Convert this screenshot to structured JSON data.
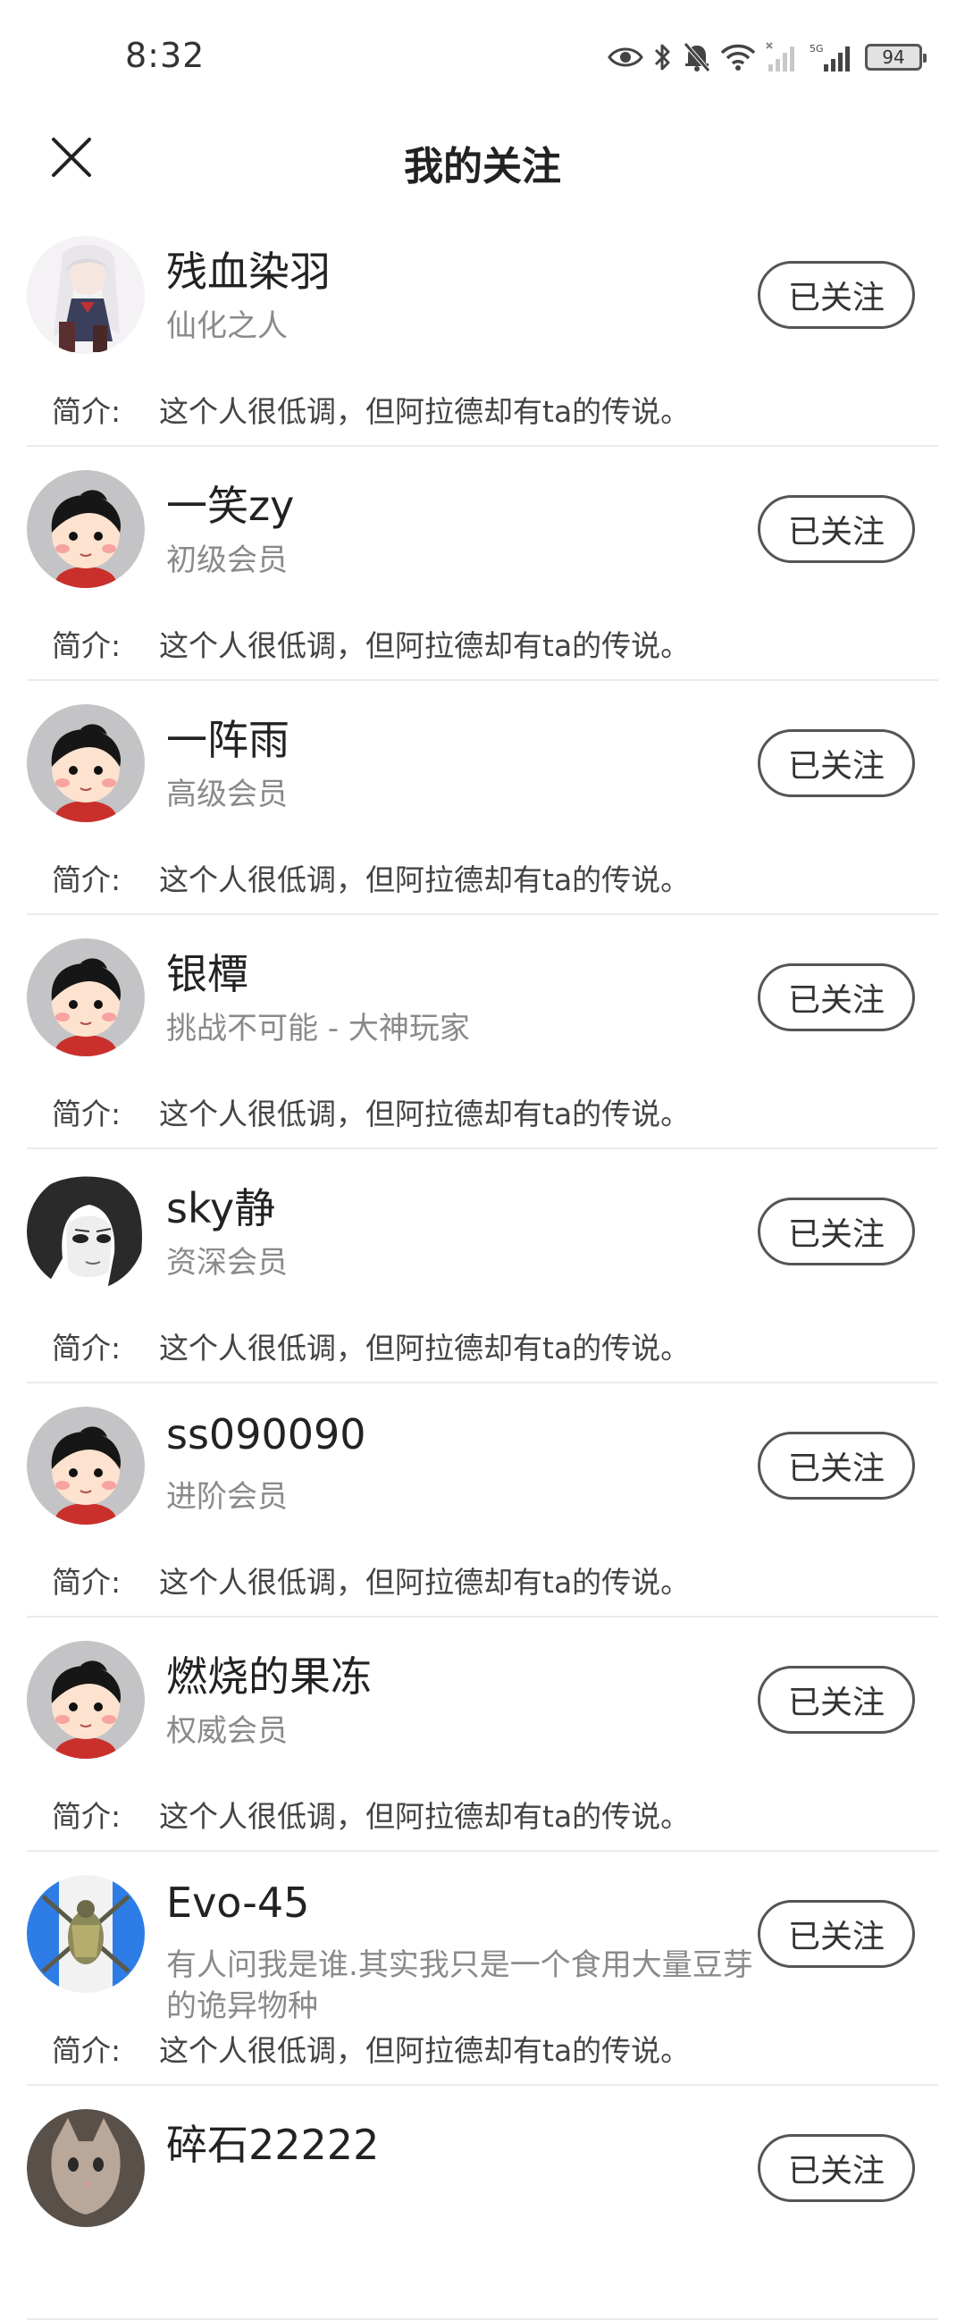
{
  "status_bar": {
    "time": "8:32",
    "battery": "94",
    "icons": [
      "eye-icon",
      "bluetooth-icon",
      "mute-bell-icon",
      "wifi-icon",
      "no-signal-icon",
      "signal-5g-icon"
    ]
  },
  "header": {
    "title": "我的关注",
    "close_icon": "close-icon"
  },
  "intro_label": "简介:",
  "follows": [
    {
      "name": "残血染羽",
      "title": "仙化之人",
      "button": "已关注",
      "intro": "这个人很低调，但阿拉德却有ta的传说。",
      "avatar": "anime-girl-avatar"
    },
    {
      "name": "一笑zy",
      "title": "初级会员",
      "button": "已关注",
      "intro": "这个人很低调，但阿拉德却有ta的传说。",
      "avatar": "default-cartoon-avatar"
    },
    {
      "name": "一阵雨",
      "title": "高级会员",
      "button": "已关注",
      "intro": "这个人很低调，但阿拉德却有ta的传说。",
      "avatar": "default-cartoon-avatar"
    },
    {
      "name": "银橝",
      "title": "挑战不可能 - 大神玩家",
      "button": "已关注",
      "intro": "这个人很低调，但阿拉德却有ta的传说。",
      "avatar": "default-cartoon-avatar"
    },
    {
      "name": "sky静",
      "title": "资深会员",
      "button": "已关注",
      "intro": "这个人很低调，但阿拉德却有ta的传说。",
      "avatar": "sketch-portrait-avatar"
    },
    {
      "name": "ss090090",
      "title": "进阶会员",
      "button": "已关注",
      "intro": "这个人很低调，但阿拉德却有ta的传说。",
      "avatar": "default-cartoon-avatar"
    },
    {
      "name": "燃烧的果冻",
      "title": "权威会员",
      "button": "已关注",
      "intro": "这个人很低调，但阿拉德却有ta的传说。",
      "avatar": "default-cartoon-avatar"
    },
    {
      "name": "Evo-45",
      "title": "有人问我是谁.其实我只是一个食用大量豆芽的诡异物种",
      "button": "已关注",
      "intro": "这个人很低调，但阿拉德却有ta的传说。",
      "avatar": "armored-bug-avatar"
    },
    {
      "name": "碎石22222",
      "title": "",
      "button": "已关注",
      "intro": "",
      "avatar": "cat-photo-avatar"
    }
  ]
}
